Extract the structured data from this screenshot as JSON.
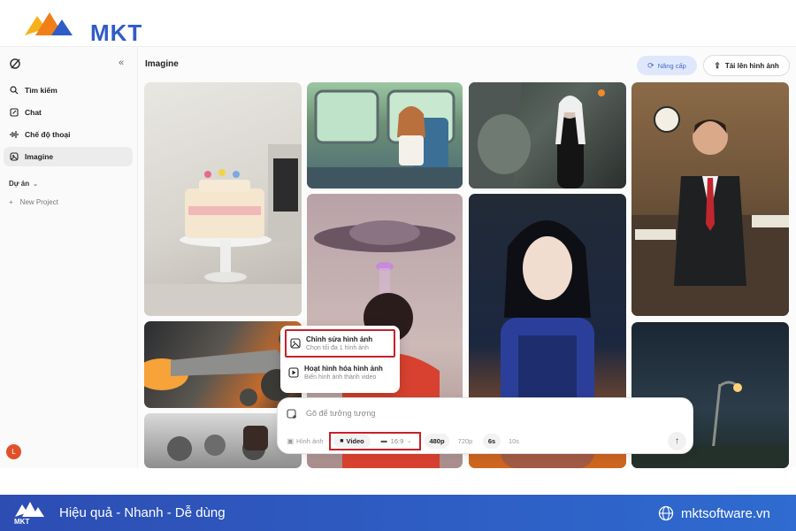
{
  "brand": {
    "name": "MKT"
  },
  "sidebar": {
    "items": [
      {
        "label": "Tìm kiếm",
        "icon": "search-icon"
      },
      {
        "label": "Chat",
        "icon": "edit-icon"
      },
      {
        "label": "Chế độ thoại",
        "icon": "voice-icon"
      },
      {
        "label": "Imagine",
        "icon": "image-icon",
        "active": true
      }
    ],
    "projects_label": "Dự án",
    "new_project_label": "New Project",
    "avatar_initial": "L"
  },
  "header": {
    "title": "Imagine",
    "upgrade_label": "Nâng cấp",
    "upload_label": "Tải lên hình ảnh"
  },
  "menu": {
    "items": [
      {
        "label": "Chỉnh sửa hình ảnh",
        "sub": "Chọn tối đa 1 hình ảnh"
      },
      {
        "label": "Hoạt hình hóa hình ảnh",
        "sub": "Biến hình ảnh thành video"
      }
    ]
  },
  "composer": {
    "placeholder": "Gõ để tưởng tượng",
    "mode_image": "Hình ảnh",
    "mode_video": "Video",
    "ratio": "16:9",
    "res_480": "480p",
    "res_720": "720p",
    "dur_6": "6s",
    "dur_10": "10s"
  },
  "footer": {
    "logo_text": "MKT",
    "slogan": "Hiệu quả - Nhanh - Dễ dùng",
    "website": "mktsoftware.vn"
  },
  "colors": {
    "brand_blue": "#2f5cc7",
    "highlight_red": "#c8202a",
    "avatar": "#e2502b",
    "upgrade_bg": "#dfe8fb"
  }
}
